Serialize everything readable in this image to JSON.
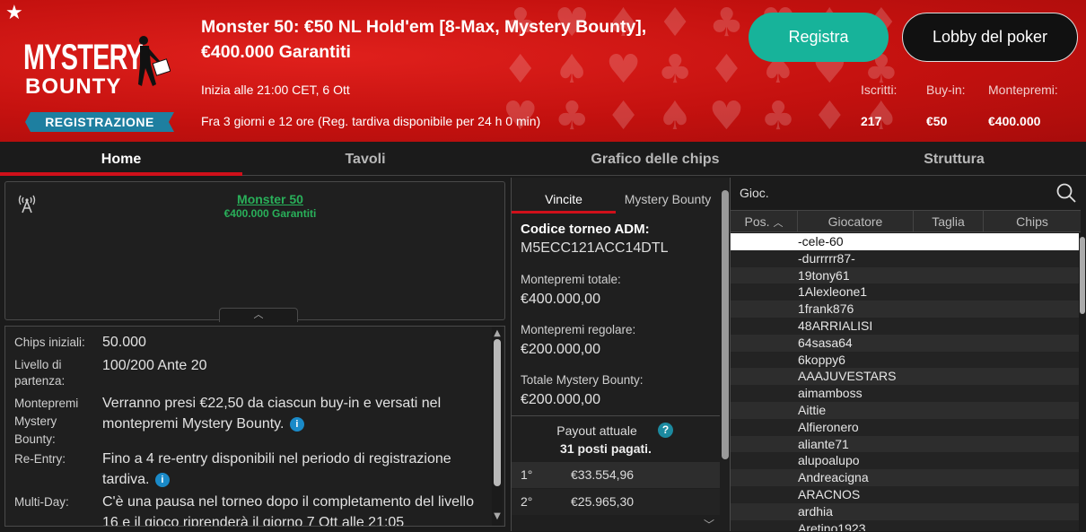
{
  "header": {
    "title": "Monster 50: €50 NL Hold'em [8-Max, Mystery Bounty], €400.000 Garantiti",
    "start": "Inizia alle 21:00 CET, 6 Ott",
    "late_reg": "Fra 3 giorni e 12 ore (Reg. tardiva disponibile per 24 h 0 min)",
    "badge": "REGISTRAZIONE",
    "logo_line1": "MYSTERY",
    "logo_line2": "BOUNTY",
    "register_button": "Registra",
    "lobby_button": "Lobby del poker",
    "stats": [
      {
        "label": "Iscritti:",
        "value": "217"
      },
      {
        "label": "Buy-in:",
        "value": "€50"
      },
      {
        "label": "Montepremi:",
        "value": "€400.000"
      }
    ]
  },
  "tabs": [
    "Home",
    "Tavoli",
    "Grafico delle chips",
    "Struttura"
  ],
  "mini": {
    "name": "Monster 50",
    "guarantee": "€400.000 Garantiti"
  },
  "info": [
    {
      "label": "Chips iniziali:",
      "value": "50.000"
    },
    {
      "label": "Livello di partenza:",
      "value": "100/200 Ante 20"
    },
    {
      "label": "Montepremi Mystery Bounty:",
      "value": "Verranno presi €22,50 da ciascun buy-in e versati nel montepremi Mystery Bounty."
    },
    {
      "label": "Re-Entry:",
      "value": "Fino a 4 re-entry disponibili nel periodo di registrazione tardiva."
    },
    {
      "label": "Multi-Day:",
      "value": "C'è una pausa nel torneo dopo il completamento del livello 16 e il gioco riprenderà il giorno 7 Ott alle 21:05"
    }
  ],
  "middle": {
    "tabs": [
      "Vincite",
      "Mystery Bounty"
    ],
    "code_label": "Codice torneo ADM:",
    "code": "M5ECC121ACC14DTL",
    "fields": [
      {
        "label": "Montepremi totale:",
        "value": "€400.000,00"
      },
      {
        "label": "Montepremi regolare:",
        "value": "€200.000,00"
      },
      {
        "label": "Totale Mystery Bounty:",
        "value": "€200.000,00"
      }
    ],
    "payout_title": "Payout attuale",
    "payout_sub": "31 posti pagati.",
    "payouts": [
      {
        "place": "1°",
        "amount": "€33.554,96"
      },
      {
        "place": "2°",
        "amount": "€25.965,30"
      }
    ]
  },
  "players": {
    "search_placeholder": "Gioc.",
    "columns": [
      "Pos.",
      "Giocatore",
      "Taglia",
      "Chips"
    ],
    "list": [
      "-cele-60",
      "-durrrrr87-",
      "19tony61",
      "1Alexleone1",
      "1frank876",
      "48ARRIALISI",
      "64sasa64",
      "6koppy6",
      "AAAJUVESTARS",
      "aimamboss",
      "Aittie",
      "Alfieronero",
      "aliante71",
      "alupoalupo",
      "Andreacigna",
      "ARACNOS",
      "ardhia",
      "Aretino1923"
    ]
  },
  "colors": {
    "header_red": "#c4110f",
    "accent_green": "#17b39a",
    "tab_underline": "#d0101a",
    "link_green": "#29b05a",
    "badge_blue": "#1e7fa0"
  }
}
